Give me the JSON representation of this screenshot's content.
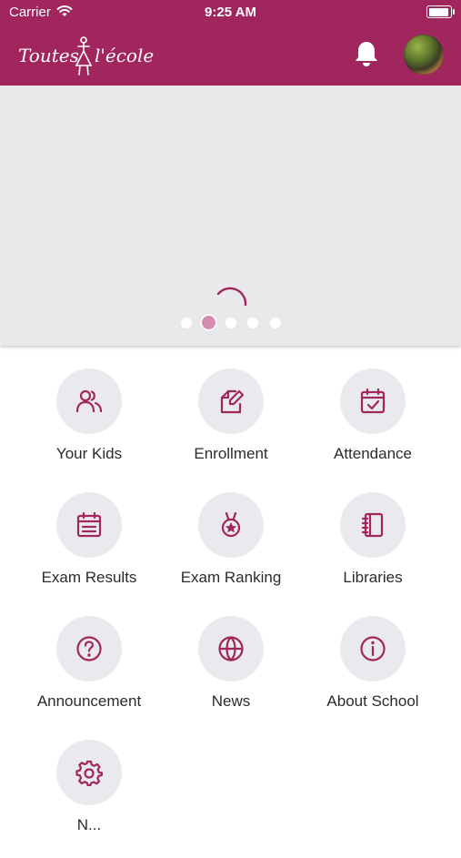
{
  "status_bar": {
    "carrier": "Carrier",
    "time": "9:25 AM"
  },
  "header": {
    "brand_color": "#a0265d",
    "logo_text_left": "Toutes",
    "logo_text_right": "l'école"
  },
  "carousel": {
    "page_count": 5,
    "active_index": 1,
    "state": "loading"
  },
  "menu": [
    {
      "label": "Your Kids",
      "icon": "users-icon"
    },
    {
      "label": "Enrollment",
      "icon": "edit-document-icon"
    },
    {
      "label": "Attendance",
      "icon": "calendar-check-icon"
    },
    {
      "label": "Exam Results",
      "icon": "calendar-list-icon"
    },
    {
      "label": "Exam Ranking",
      "icon": "medal-icon"
    },
    {
      "label": "Libraries",
      "icon": "notebook-icon"
    },
    {
      "label": "Announcement",
      "icon": "question-circle-icon"
    },
    {
      "label": "News",
      "icon": "globe-icon"
    },
    {
      "label": "About School",
      "icon": "info-circle-icon"
    },
    {
      "label": "N...",
      "icon": "gear-icon"
    }
  ],
  "colors": {
    "accent": "#a0265d",
    "icon_bg": "#eaeaee",
    "banner_bg": "#e9e9ec",
    "active_dot": "#d88bb0"
  }
}
